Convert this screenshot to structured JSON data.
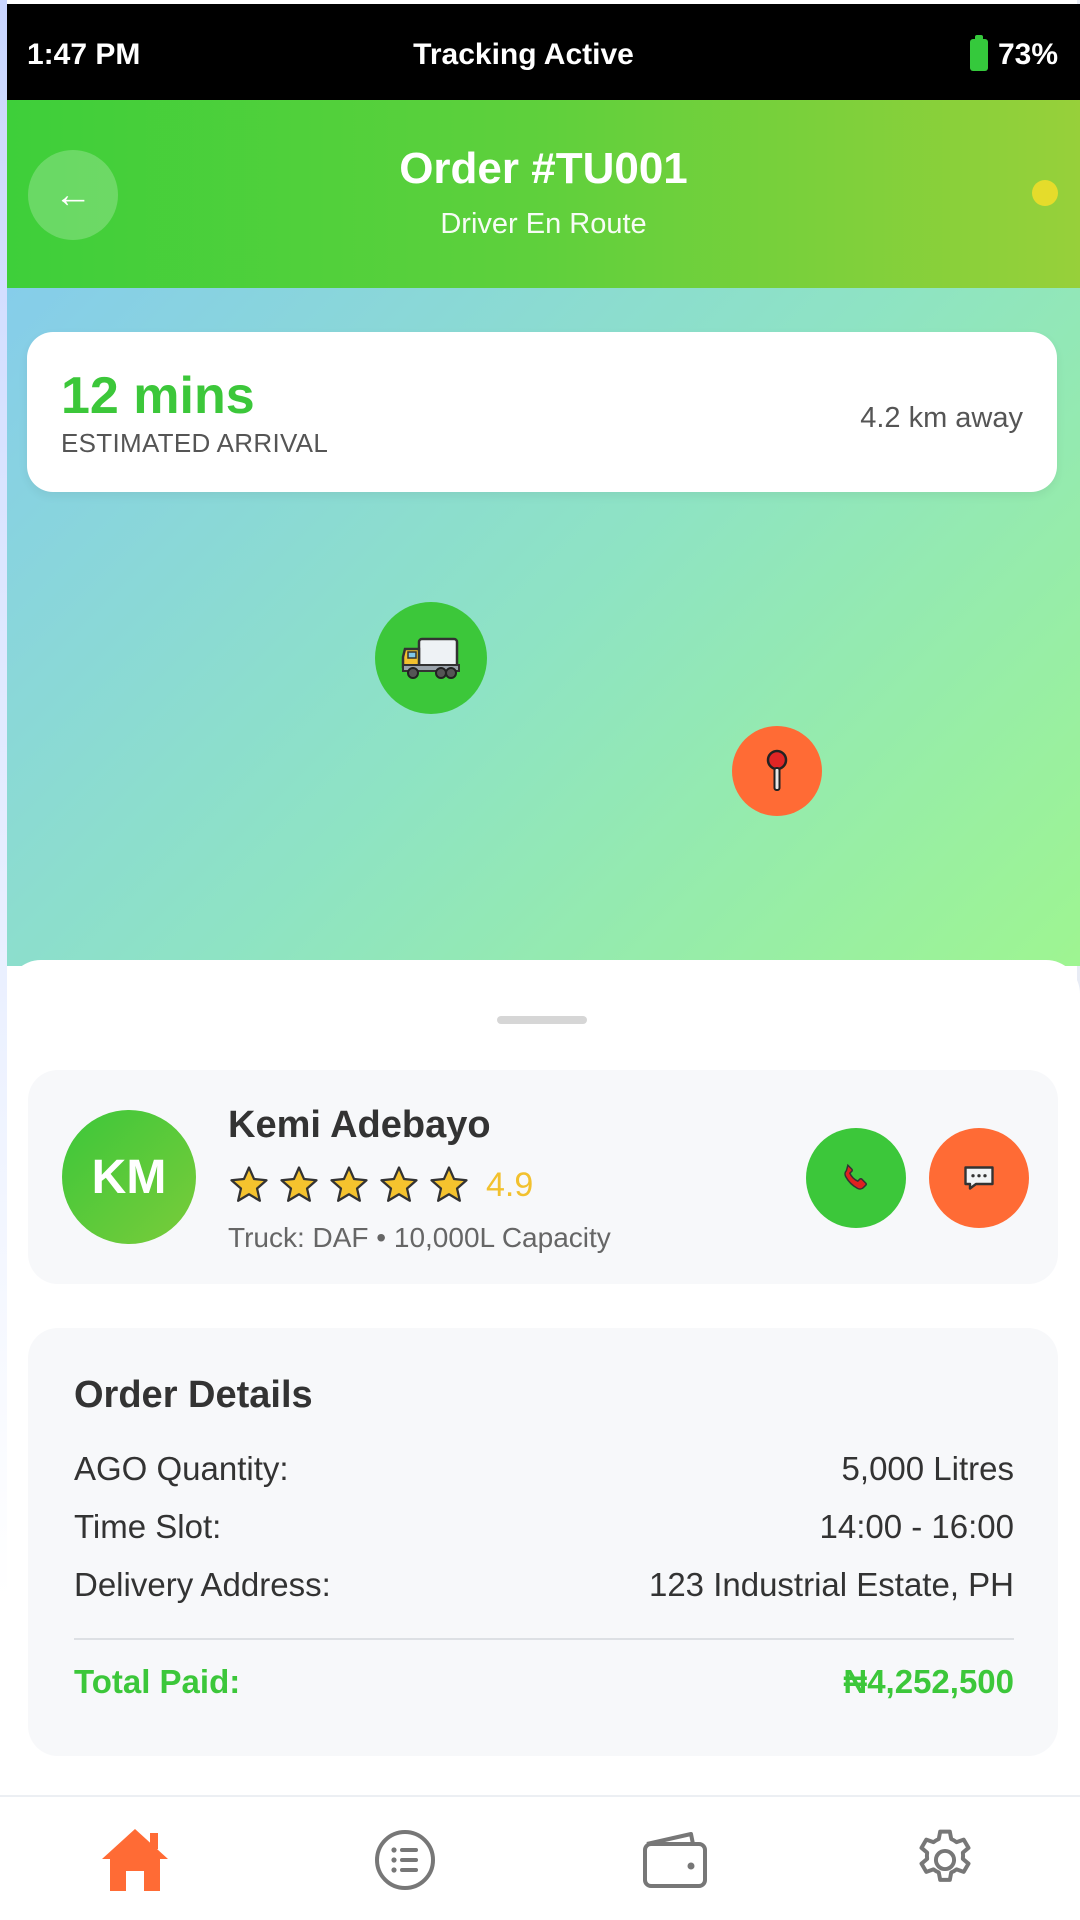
{
  "status_bar": {
    "time": "1:47 PM",
    "center_text": "Tracking Active",
    "battery": "73%"
  },
  "header": {
    "title": "Order #TU001",
    "subtitle": "Driver En Route",
    "back_icon": "arrow-left-icon"
  },
  "eta": {
    "value": "12 mins",
    "label": "ESTIMATED ARRIVAL",
    "distance": "4.2 km away"
  },
  "map": {
    "driver_marker_icon": "truck-icon",
    "destination_marker_icon": "location-pin-icon"
  },
  "driver": {
    "initials": "KM",
    "name": "Kemi Adebayo",
    "rating_stars": 5,
    "rating": "4.9",
    "truck_info": "Truck: DAF • 10,000L Capacity",
    "call_icon": "phone-icon",
    "message_icon": "chat-icon"
  },
  "order_details": {
    "title": "Order Details",
    "rows": [
      {
        "label": "AGO Quantity:",
        "value": "5,000 Litres"
      },
      {
        "label": "Time Slot:",
        "value": "14:00 - 16:00"
      },
      {
        "label": "Delivery Address:",
        "value": "123 Industrial Estate, PH"
      }
    ],
    "total_label": "Total Paid:",
    "total_value": "₦4,252,500"
  },
  "bottom_nav": {
    "items": [
      "home-icon",
      "list-icon",
      "wallet-icon",
      "settings-icon"
    ],
    "active": "home-icon"
  },
  "colors": {
    "brand_green": "#3cc73a",
    "accent_orange": "#ff6b35",
    "star_yellow": "#f2c12e"
  }
}
